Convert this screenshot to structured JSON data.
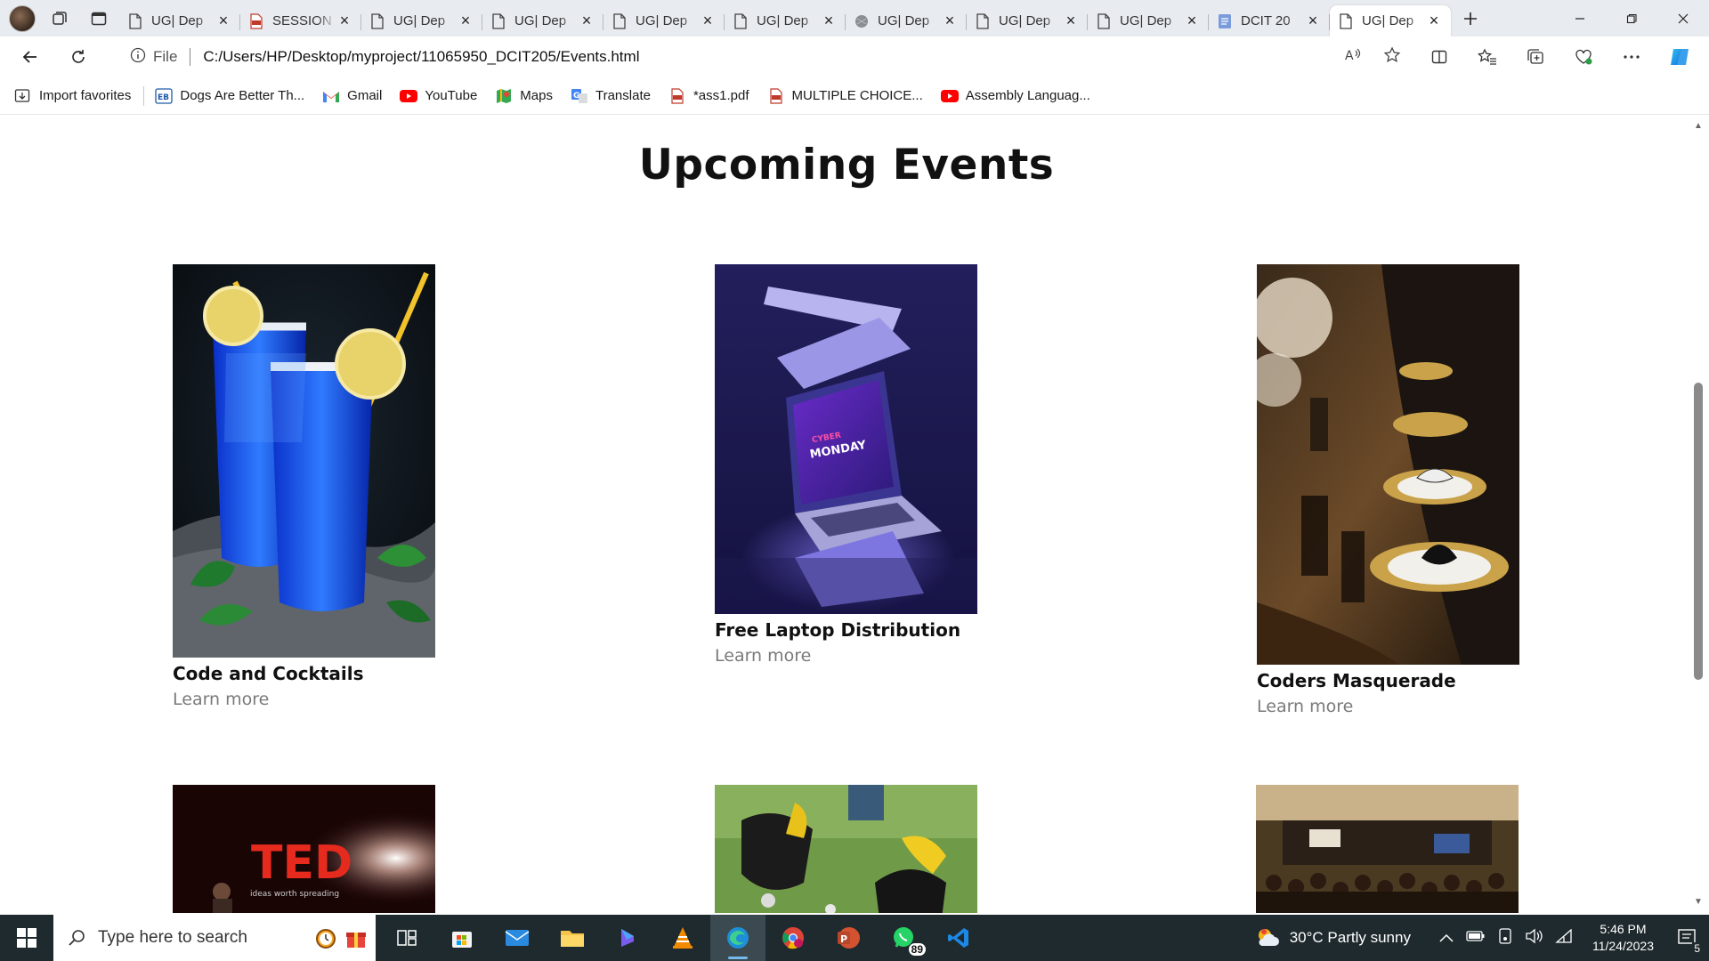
{
  "browser": {
    "tabs": [
      {
        "title": "UG| Dep",
        "icon": "page-icon"
      },
      {
        "title": "SESSION",
        "icon": "pdf-icon"
      },
      {
        "title": "UG| Dep",
        "icon": "page-icon"
      },
      {
        "title": "UG| Dep",
        "icon": "page-icon"
      },
      {
        "title": "UG| Dep",
        "icon": "page-icon"
      },
      {
        "title": "UG| Dep",
        "icon": "page-icon"
      },
      {
        "title": "UG| Dep",
        "icon": "sleeping-tab-icon"
      },
      {
        "title": "UG| Dep",
        "icon": "page-icon"
      },
      {
        "title": "UG| Dep",
        "icon": "page-icon"
      },
      {
        "title": "DCIT 20",
        "icon": "doc-icon"
      },
      {
        "title": "UG| Dep",
        "icon": "page-icon",
        "active": true
      }
    ],
    "address": {
      "scheme_label": "File",
      "url": "C:/Users/HP/Desktop/myproject/11065950_DCIT205/Events.html"
    },
    "favorites": [
      {
        "label": "Import favorites",
        "icon": "import-icon"
      },
      {
        "label": "Dogs Are Better Th...",
        "icon": "eb-icon"
      },
      {
        "label": "Gmail",
        "icon": "gmail-icon"
      },
      {
        "label": "YouTube",
        "icon": "youtube-icon"
      },
      {
        "label": "Maps",
        "icon": "maps-icon"
      },
      {
        "label": "Translate",
        "icon": "translate-icon"
      },
      {
        "label": "*ass1.pdf",
        "icon": "pdf-icon"
      },
      {
        "label": "MULTIPLE CHOICE...",
        "icon": "pdf-icon"
      },
      {
        "label": "Assembly Languag...",
        "icon": "youtube-icon"
      }
    ]
  },
  "page": {
    "title": "Upcoming Events",
    "events": [
      {
        "name": "Code and Cocktails",
        "link": "Learn more"
      },
      {
        "name": "Free Laptop Distribution",
        "link": "Learn more"
      },
      {
        "name": "Coders Masquerade",
        "link": "Learn more"
      },
      {
        "name": "",
        "link": ""
      },
      {
        "name": "",
        "link": ""
      },
      {
        "name": "",
        "link": ""
      }
    ],
    "image_texts": {
      "laptop_screen_line1": "CYBER",
      "laptop_screen_line2": "MONDAY",
      "ted_logo": "TED",
      "ted_tagline": "ideas worth spreading"
    }
  },
  "taskbar": {
    "search_placeholder": "Type here to search",
    "whatsapp_badge": "89",
    "weather": "30°C  Partly sunny",
    "time": "5:46 PM",
    "date": "11/24/2023",
    "notifications": "5"
  }
}
